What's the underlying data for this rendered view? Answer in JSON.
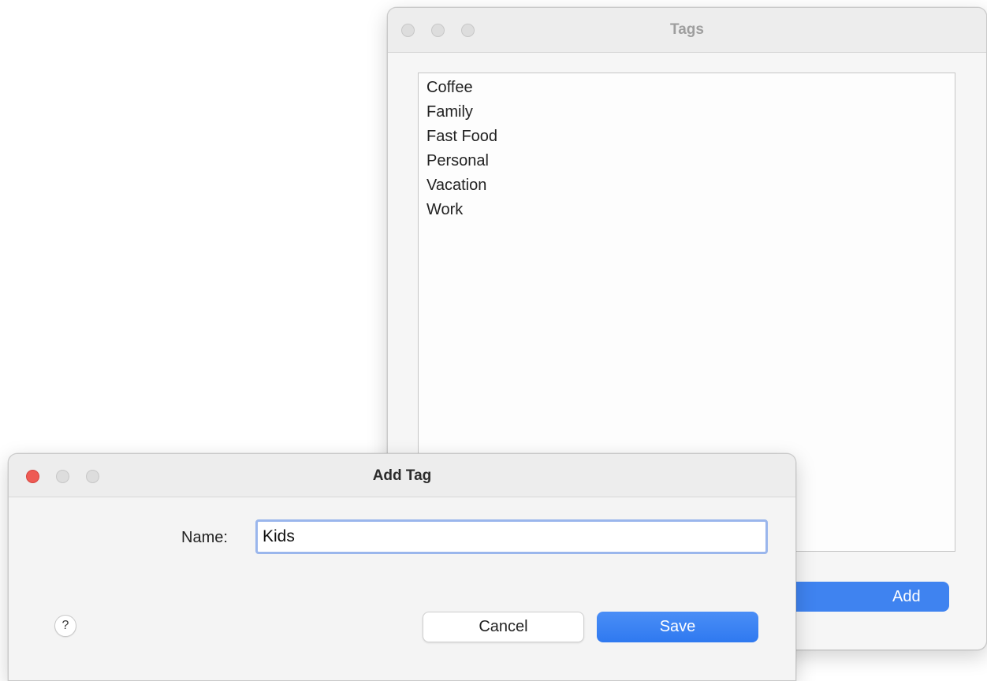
{
  "tags_window": {
    "title": "Tags",
    "tags": [
      "Coffee",
      "Family",
      "Fast Food",
      "Personal",
      "Vacation",
      "Work"
    ],
    "add_label": "Add"
  },
  "add_tag_dialog": {
    "title": "Add Tag",
    "name_label": "Name:",
    "name_value": "Kids",
    "help_label": "?",
    "cancel_label": "Cancel",
    "save_label": "Save"
  },
  "colors": {
    "accent": "#3f83f0",
    "close_button": "#ee5b54",
    "focus_ring": "#9ab6ec"
  }
}
